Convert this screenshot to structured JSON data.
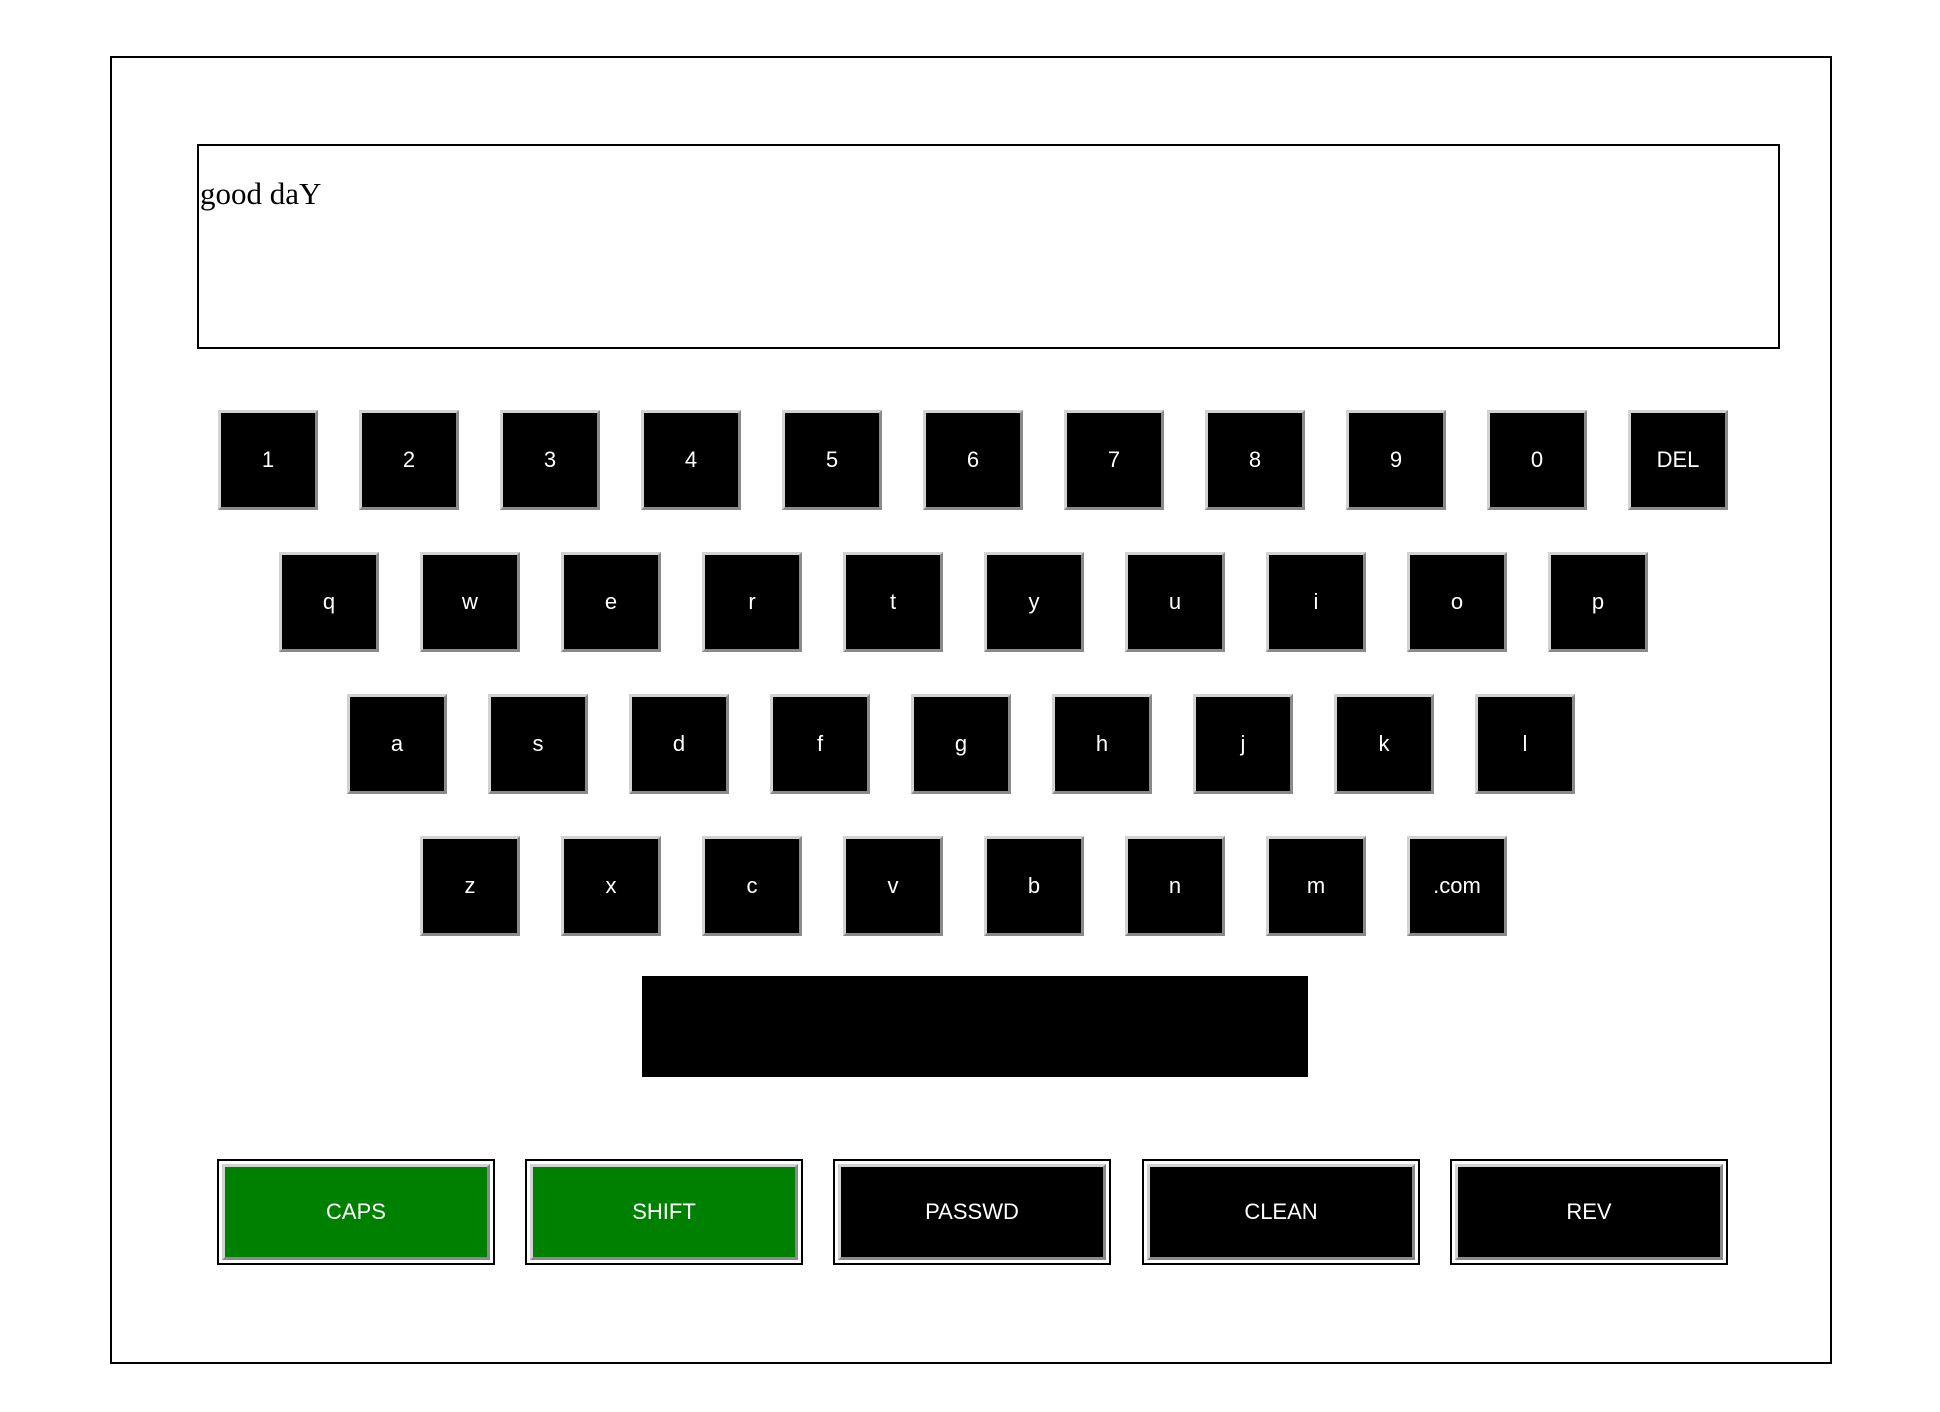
{
  "display": {
    "text": "good daY"
  },
  "keyboard": {
    "rows": [
      [
        "1",
        "2",
        "3",
        "4",
        "5",
        "6",
        "7",
        "8",
        "9",
        "0",
        "DEL"
      ],
      [
        "q",
        "w",
        "e",
        "r",
        "t",
        "y",
        "u",
        "i",
        "o",
        "p"
      ],
      [
        "a",
        "s",
        "d",
        "f",
        "g",
        "h",
        "j",
        "k",
        "l"
      ],
      [
        "z",
        "x",
        "c",
        "v",
        "b",
        "n",
        "m",
        ".com"
      ]
    ],
    "space": ""
  },
  "functions": [
    {
      "label": "CAPS",
      "active": true
    },
    {
      "label": "SHIFT",
      "active": true
    },
    {
      "label": "PASSWD",
      "active": false
    },
    {
      "label": "CLEAN",
      "active": false
    },
    {
      "label": "REV",
      "active": false
    }
  ],
  "colors": {
    "key": "#000000",
    "key_text": "#ffffff",
    "active": "#008000",
    "border": "#000000"
  }
}
